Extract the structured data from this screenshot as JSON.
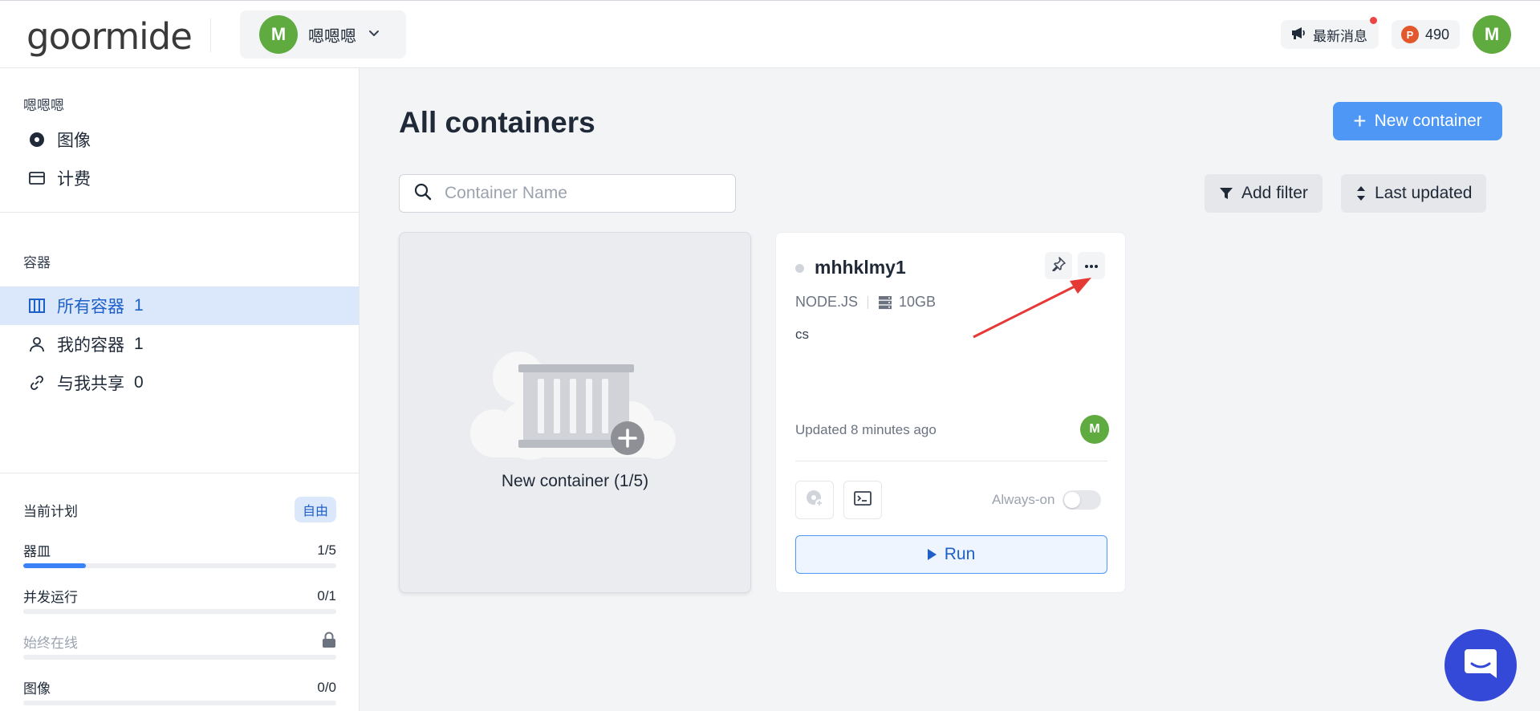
{
  "header": {
    "logo": "goormide",
    "workspace": {
      "avatar_letter": "M",
      "name": "嗯嗯嗯"
    },
    "news_label": "最新消息",
    "points": {
      "badge": "P",
      "value": "490"
    },
    "user_avatar_letter": "M"
  },
  "sidebar": {
    "workspace_title": "嗯嗯嗯",
    "top_items": [
      {
        "label": "图像",
        "icon": "disc-icon"
      },
      {
        "label": "计费",
        "icon": "credit-card-icon"
      }
    ],
    "containers_title": "容器",
    "container_items": [
      {
        "label": "所有容器",
        "count": "1",
        "icon": "columns-icon",
        "active": true
      },
      {
        "label": "我的容器",
        "count": "1",
        "icon": "user-icon"
      },
      {
        "label": "与我共享",
        "count": "0",
        "icon": "link-icon"
      }
    ],
    "plan": {
      "title": "当前计划",
      "badge": "自由",
      "rows": [
        {
          "label": "器皿",
          "value": "1/5",
          "progress": 0.2
        },
        {
          "label": "并发运行",
          "value": "0/1",
          "progress": 0
        },
        {
          "label": "始终在线",
          "value": "",
          "locked": true,
          "progress": 0
        },
        {
          "label": "图像",
          "value": "0/0",
          "progress": 0
        }
      ]
    }
  },
  "main": {
    "title": "All containers",
    "new_container_label": "New container",
    "search_placeholder": "Container Name",
    "filter_label": "Add filter",
    "sort_label": "Last updated",
    "new_card_label": "New container (1/5)",
    "container": {
      "name": "mhhklmy1",
      "stack": "NODE.JS",
      "disk": "10GB",
      "description": "cs",
      "updated": "Updated 8 minutes ago",
      "owner_letter": "M",
      "always_on_label": "Always-on",
      "run_label": "Run"
    }
  },
  "colors": {
    "accent": "#4e97f5",
    "avatar_green": "#5fab3f",
    "active_bg": "#dbe8fb",
    "chat_fab": "#3449d8",
    "annotation_arrow": "#e53935"
  }
}
